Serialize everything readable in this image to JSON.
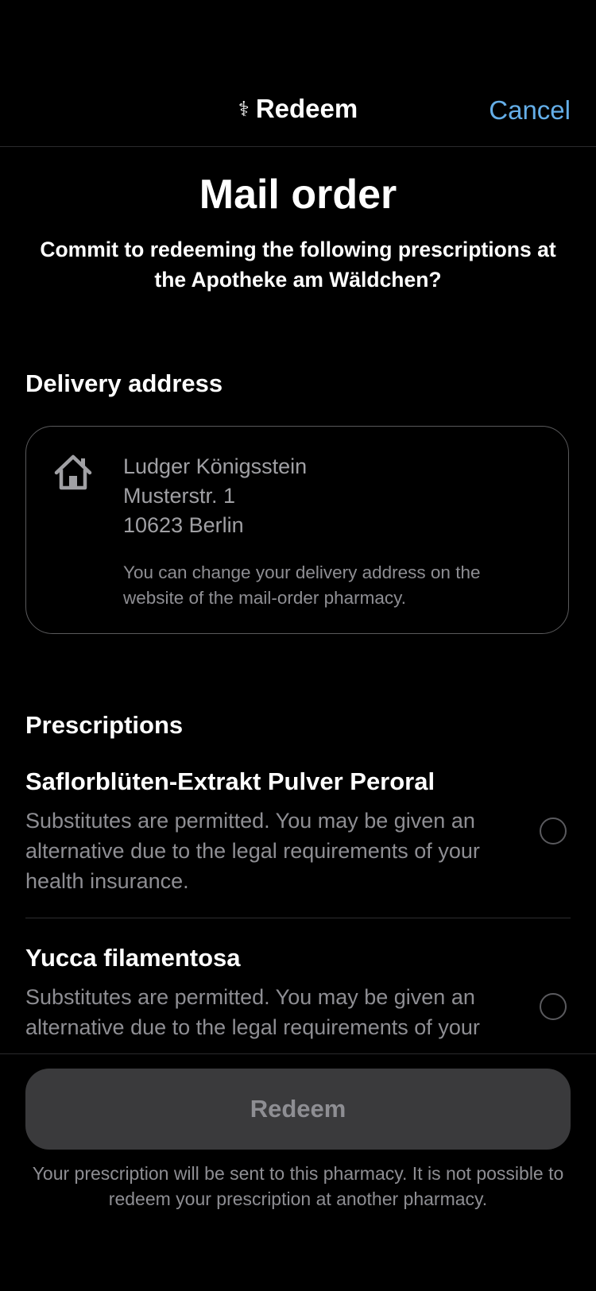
{
  "navbar": {
    "title": "Redeem",
    "title_icon": "caduceus-icon",
    "cancel_label": "Cancel",
    "accent_color": "#64aee8"
  },
  "heading": "Mail order",
  "subheading": "Commit to redeeming the following prescriptions at the Apotheke am Wäldchen?",
  "delivery": {
    "section_title": "Delivery address",
    "icon": "house-icon",
    "name": "Ludger Königsstein",
    "street": "Musterstr. 1",
    "city": "10623 Berlin",
    "note": "You can change your delivery address on the website of the mail-order pharmacy."
  },
  "prescriptions": {
    "section_title": "Prescriptions",
    "items": [
      {
        "name": "Saflorblüten-Extrakt Pulver Peroral",
        "description": "Substitutes are permitted. You may be given an alternative due to the legal requirements of your health insurance.",
        "selected": false
      },
      {
        "name": "Yucca filamentosa",
        "description": "Substitutes are permitted. You may be given an alternative due to the legal requirements of your",
        "selected": false
      }
    ]
  },
  "footer": {
    "redeem_label": "Redeem",
    "note": "Your prescription will be sent to this pharmacy. It is not possible to redeem your prescription at another pharmacy."
  }
}
